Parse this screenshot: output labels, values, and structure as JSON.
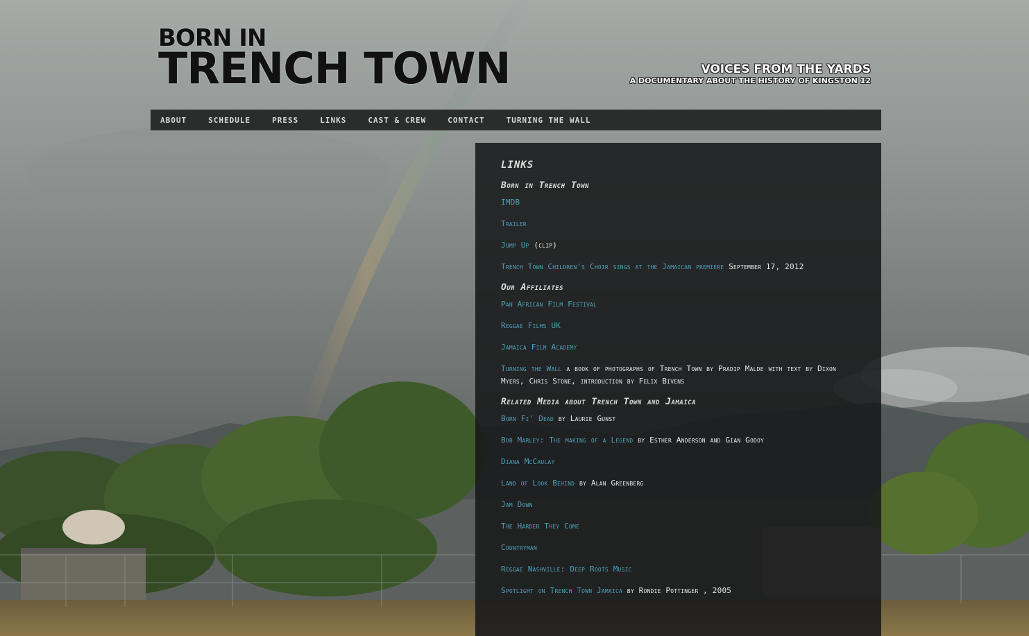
{
  "header": {
    "logo_line1": "BORN IN",
    "logo_line2": "TRENCH TOWN",
    "tagline_main": "VOICES FROM THE YARDS",
    "tagline_sub": "A DOCUMENTARY ABOUT THE HISTORY OF KINGSTON 12"
  },
  "nav": {
    "items": [
      "ABOUT",
      "SCHEDULE",
      "PRESS",
      "LINKS",
      "CAST & CREW",
      "CONTACT",
      "TURNING THE WALL"
    ]
  },
  "content": {
    "title": "LINKS",
    "sections": [
      {
        "heading": "Born in Trench Town",
        "entries": [
          {
            "link": "IMDB",
            "note": ""
          },
          {
            "link": "Trailer",
            "note": ""
          },
          {
            "link": "Jump Up",
            "note": " (clip)"
          },
          {
            "link": "Trench Town Children's Choir sings at the Jamaican premiere",
            "note": " September 17, 2012"
          }
        ]
      },
      {
        "heading": "Our Affiliates",
        "entries": [
          {
            "link": "Pan African Film Festival",
            "note": ""
          },
          {
            "link": "Reggae Films UK",
            "note": ""
          },
          {
            "link": "Jamaica Film Academy",
            "note": ""
          },
          {
            "link": "Turning the Wall",
            "note": " a book of photographs of Trench Town by Pradip Malde with text by Dixon Myers, Chris Stone, introduction by Felix Bivens"
          }
        ]
      },
      {
        "heading": "Related Media about Trench Town and Jamaica",
        "entries": [
          {
            "link": "Born Fi' Dead",
            "note": " by Laurie Gunst"
          },
          {
            "link": "Bob Marley: The making of a Legend",
            "note": " by Esther Anderson and Gian Godoy"
          },
          {
            "link": "Diana McCaulay",
            "note": ""
          },
          {
            "link": "Land of Look Behind",
            "note": " by Alan Greenberg"
          },
          {
            "link": "Jam Down",
            "note": ""
          },
          {
            "link": "The Harder They Come",
            "note": ""
          },
          {
            "link": "Countryman",
            "note": ""
          },
          {
            "link": "Reggae Nashville: Deep Roots Music",
            "note": ""
          },
          {
            "link": "Spotlight on Trench Town Jamaica",
            "note": " by Rondie Pottinger , 2005"
          }
        ]
      }
    ]
  },
  "colors": {
    "link": "#4fa0bb",
    "nav_bg": "#2b2c2c",
    "panel_bg": "rgba(24,25,26,0.88)"
  }
}
